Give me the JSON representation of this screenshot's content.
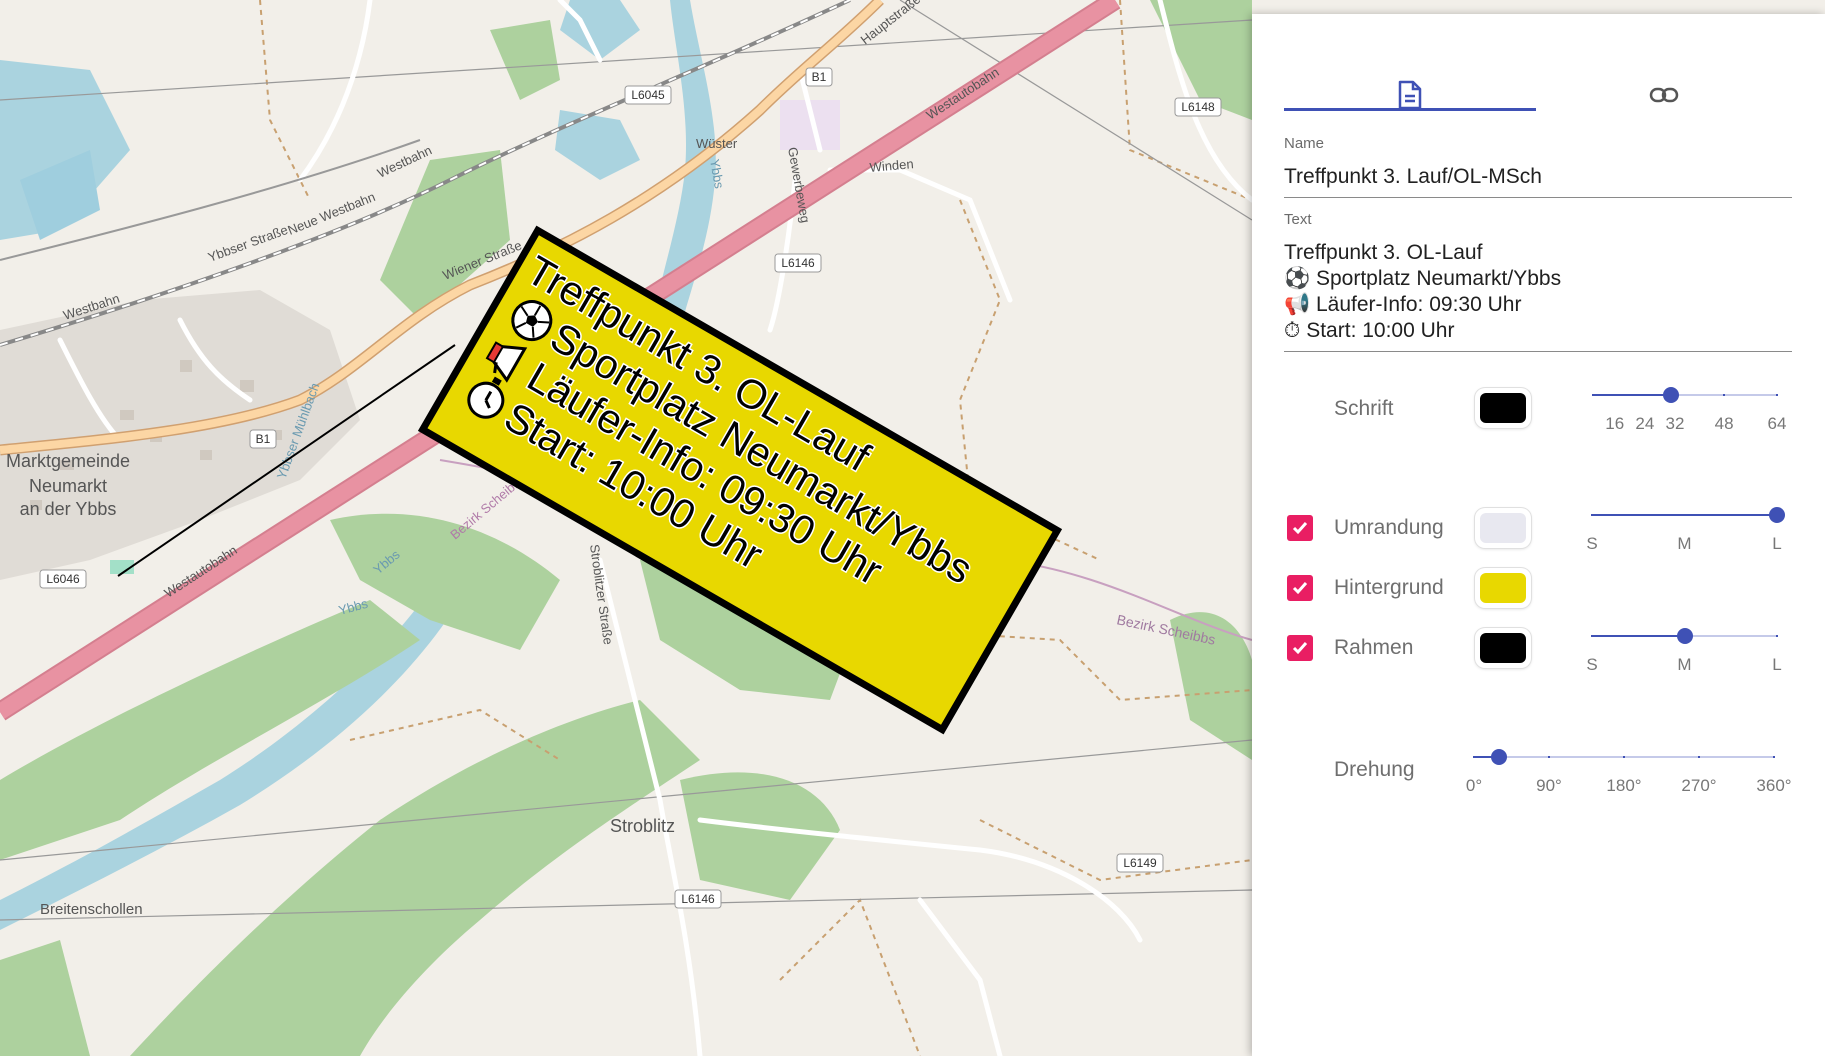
{
  "map": {
    "places": [
      "Marktgemeinde",
      "Neumarkt",
      "an der Ybbs",
      "Stroblitz",
      "Breitenschollen",
      "Wüster",
      "Winden",
      "Bezirk Scheibbs"
    ],
    "roads": [
      "Westautobahn",
      "Westautobahn",
      "Hauptstraße",
      "Ybbser Straße",
      "Neue Westbahn",
      "Westbahn",
      "Westbahn",
      "Wiener Straße",
      "Stroblitzer Straße",
      "Ybbs",
      "Ybbs",
      "Ybbs",
      "Gewerbeweg",
      "Winden",
      "Ybbser Mühlbach",
      "Bezirk Scheibbs"
    ],
    "shields": [
      "L6045",
      "B1",
      "L6148",
      "L6146",
      "B1",
      "L6046",
      "L6146",
      "L6149"
    ],
    "colors": {
      "background": "#f2efe9",
      "motorway": "#e8909c",
      "primary_road": "#f9cb8c",
      "water": "#aad3df",
      "forest": "#a8d5a2"
    }
  },
  "callout": {
    "lines": [
      "Treffpunkt 3. OL-Lauf",
      "Sportplatz Neumarkt/Ybbs",
      "Läufer-Info: 09:30 Uhr",
      "Start: 10:00 Uhr"
    ],
    "icons": [
      "soccer-ball-icon",
      "megaphone-icon",
      "stopwatch-icon"
    ],
    "background_color": "#e8d800",
    "border_color": "#000000",
    "text_color": "#000000",
    "rotation_degrees": 30
  },
  "panel": {
    "tabs": [
      {
        "icon": "document-icon",
        "active": true
      },
      {
        "icon": "link-icon",
        "active": false
      }
    ],
    "name": {
      "label": "Name",
      "value": "Treffpunkt 3. Lauf/OL-MSch"
    },
    "text": {
      "label": "Text",
      "lines": [
        "Treffpunkt 3. OL-Lauf",
        "⚽ Sportplatz Neumarkt/Ybbs",
        "📢 Läufer-Info: 09:30 Uhr",
        "⏱ Start: 10:00 Uhr"
      ]
    },
    "font": {
      "label": "Schrift",
      "color": "#000000",
      "size": 32,
      "ticks": [
        "16",
        "24",
        "32",
        "48",
        "64"
      ]
    },
    "outline": {
      "label": "Umrandung",
      "checked": true,
      "color": "#e8e8f0",
      "value": "L",
      "ticks": [
        "S",
        "M",
        "L"
      ]
    },
    "background": {
      "label": "Hintergrund",
      "checked": true,
      "color": "#e8d800"
    },
    "frame": {
      "label": "Rahmen",
      "checked": true,
      "color": "#000000",
      "value": "M",
      "ticks": [
        "S",
        "M",
        "L"
      ]
    },
    "rotation": {
      "label": "Drehung",
      "value": 30,
      "ticks": [
        "0°",
        "90°",
        "180°",
        "270°",
        "360°"
      ]
    }
  }
}
